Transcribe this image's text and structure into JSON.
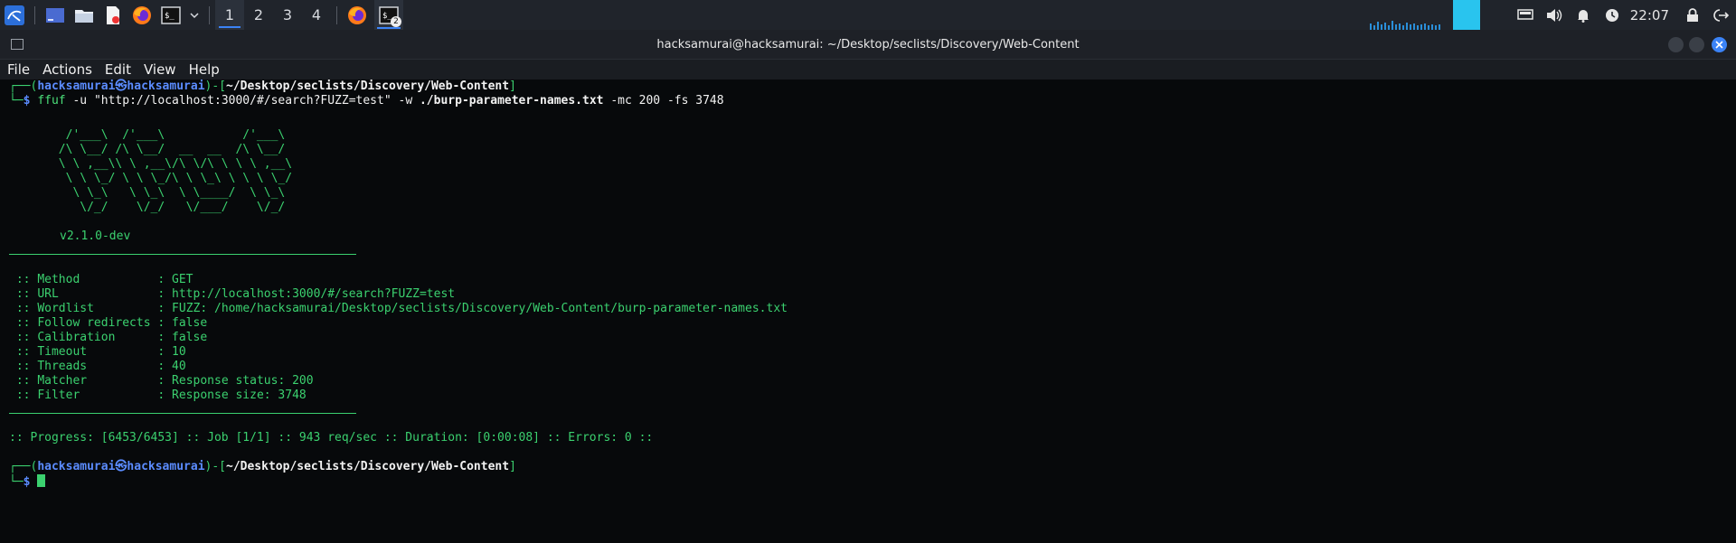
{
  "taskbar": {
    "workspaces": [
      "1",
      "2",
      "3",
      "4"
    ],
    "active_workspace": "1",
    "terminal_badge": "2",
    "clock": "22:07",
    "icons": [
      "kali-menu-icon",
      "show-desktop-icon",
      "file-manager-icon",
      "text-editor-icon",
      "firefox-icon",
      "terminal-icon",
      "chevron-down-icon"
    ],
    "accent": "#3b83f7"
  },
  "window": {
    "title": "hacksamurai@hacksamurai: ~/Desktop/seclists/Discovery/Web-Content",
    "controls": [
      "minimize",
      "maximize",
      "close"
    ],
    "close_color": "#3b83f7"
  },
  "menu": [
    "File",
    "Actions",
    "Edit",
    "View",
    "Help"
  ],
  "prompt": {
    "user": "hacksamurai",
    "host": "hacksamurai",
    "at": "㉿",
    "path": "~/Desktop/seclists/Discovery/Web-Content",
    "symbol": "$"
  },
  "command": {
    "bin": "ffuf",
    "flag_u": "-u",
    "url": "\"http://localhost:3000/#/search?FUZZ=test\"",
    "flag_w": "-w",
    "wordlist": "./burp-parameter-names.txt",
    "flag_mc": "-mc",
    "mc_val": "200",
    "flag_fs": "-fs",
    "fs_val": "3748"
  },
  "banner": {
    "art": [
      "        /'___\\  /'___\\           /'___\\       ",
      "       /\\ \\__/ /\\ \\__/  __  __  /\\ \\__/       ",
      "       \\ \\ ,__\\\\ \\ ,__\\/\\ \\/\\ \\ \\ \\ ,__\\      ",
      "        \\ \\ \\_/ \\ \\ \\_/\\ \\ \\_\\ \\ \\ \\ \\_/      ",
      "         \\ \\_\\   \\ \\_\\  \\ \\____/  \\ \\_\\       ",
      "          \\/_/    \\/_/   \\/___/    \\/_/       "
    ],
    "version": "v2.1.0-dev"
  },
  "config": [
    {
      "key": "Method",
      "value": "GET"
    },
    {
      "key": "URL",
      "value": "http://localhost:3000/#/search?FUZZ=test"
    },
    {
      "key": "Wordlist",
      "value": "FUZZ: /home/hacksamurai/Desktop/seclists/Discovery/Web-Content/burp-parameter-names.txt"
    },
    {
      "key": "Follow redirects",
      "value": "false"
    },
    {
      "key": "Calibration",
      "value": "false"
    },
    {
      "key": "Timeout",
      "value": "10"
    },
    {
      "key": "Threads",
      "value": "40"
    },
    {
      "key": "Matcher",
      "value": "Response status: 200"
    },
    {
      "key": "Filter",
      "value": "Response size: 3748"
    }
  ],
  "progress": ":: Progress: [6453/6453] :: Job [1/1] :: 943 req/sec :: Duration: [0:00:08] :: Errors: 0 ::",
  "terminal_colors": {
    "green": "#3bd16f",
    "blue": "#5b8cff",
    "bg": "#07090b"
  }
}
